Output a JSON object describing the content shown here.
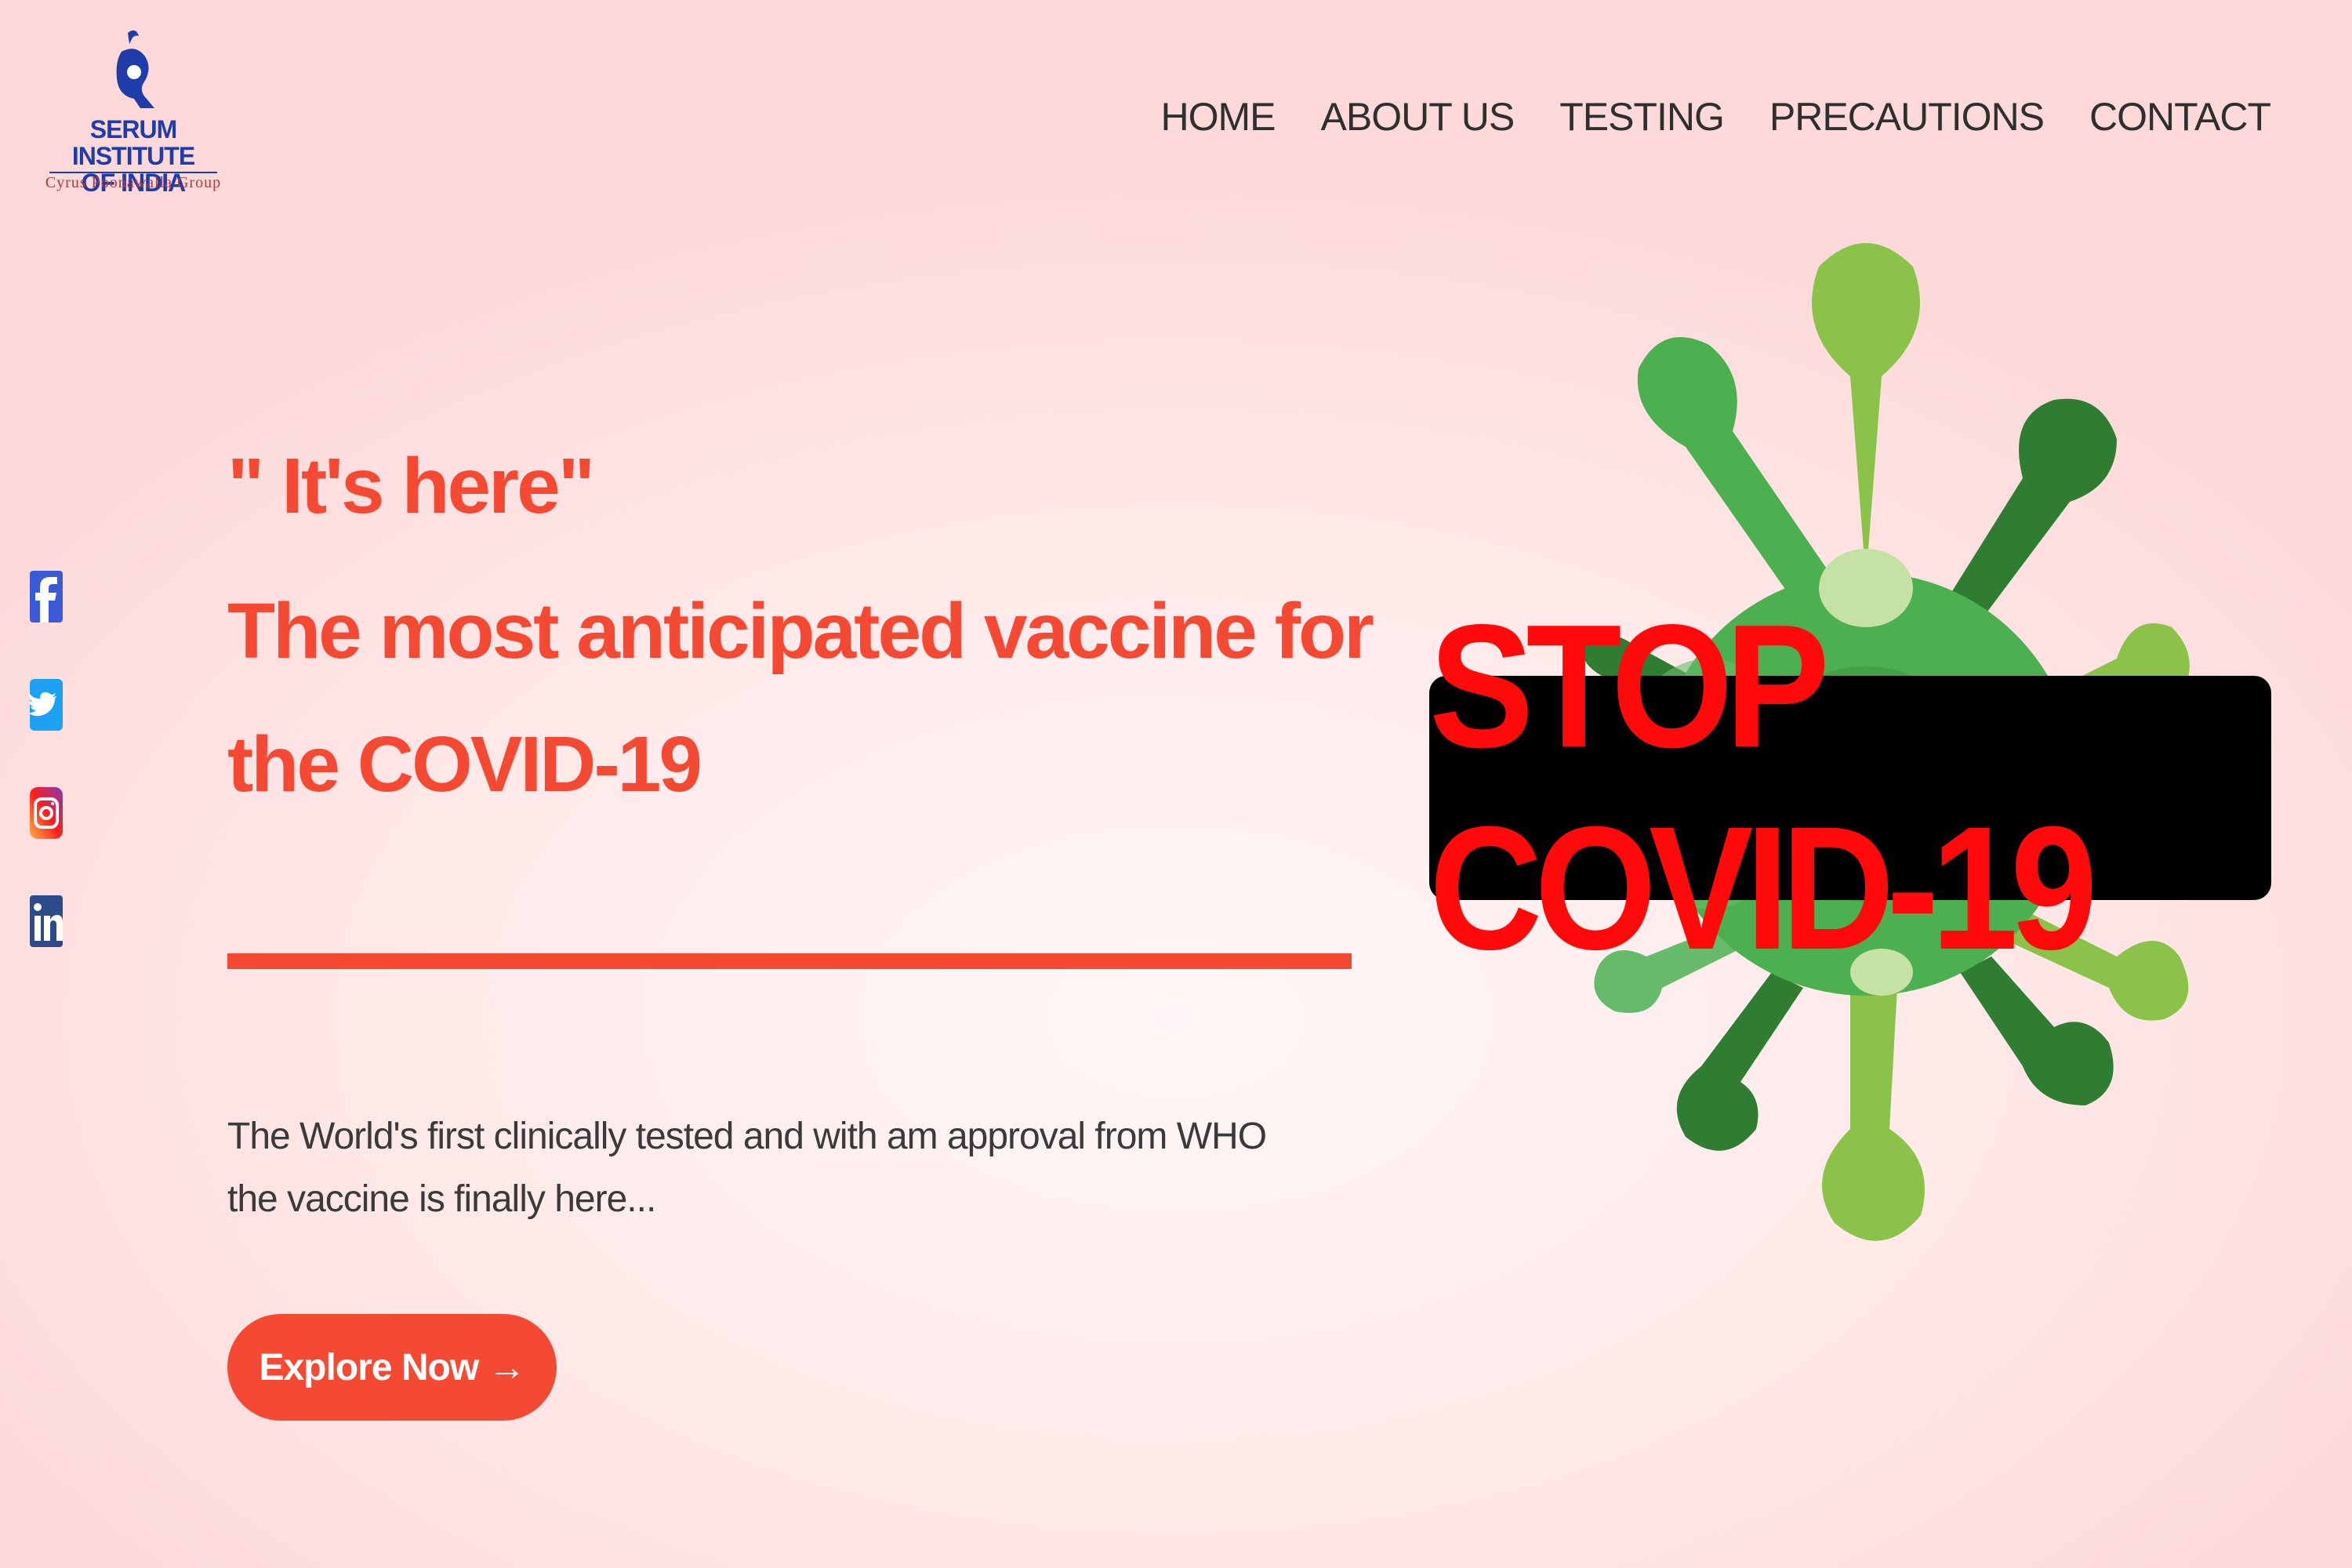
{
  "brand": {
    "name_line1": "SERUM INSTITUTE",
    "name_line2": "OF INDIA",
    "group": "Cyrus Poonawalla Group",
    "color": "#1f3da8"
  },
  "nav": {
    "items": [
      "HOME",
      "ABOUT US",
      "TESTING",
      "PRECAUTIONS",
      "CONTACT"
    ]
  },
  "social": {
    "icons": [
      "facebook-icon",
      "twitter-icon",
      "instagram-icon",
      "linkedin-icon"
    ]
  },
  "hero": {
    "tagline": "\" It's here\"",
    "headline": "The most anticipated vaccine for the COVID-19",
    "description_line1": "The World's first clinically tested and with am approval from WHO",
    "description_line2": "the vaccine is finally here...",
    "cta_label": "Explore Now →",
    "accent_color": "#f44a34"
  },
  "banner": {
    "text": "STOP COVID-19"
  }
}
